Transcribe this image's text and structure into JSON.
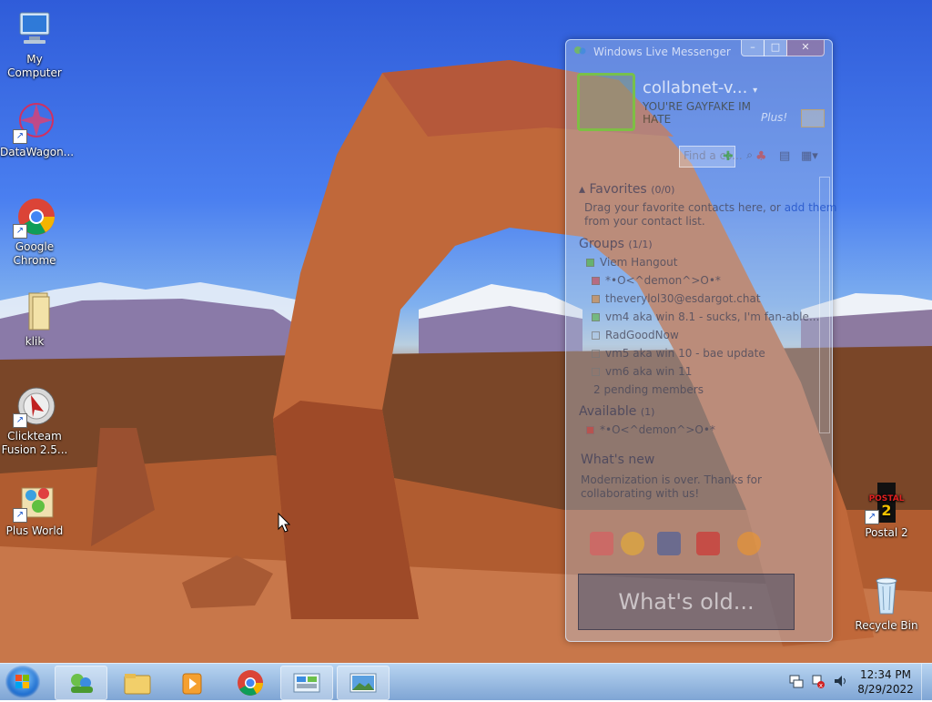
{
  "desktop": {
    "icons": [
      {
        "label": "My Computer",
        "icon": "computer-icon"
      },
      {
        "label": "DataWagon...",
        "icon": "datawagon-icon"
      },
      {
        "label": "Google Chrome",
        "icon": "chrome-icon"
      },
      {
        "label": "klik",
        "icon": "folder-icon"
      },
      {
        "label": "Clickteam Fusion 2.5...",
        "icon": "clickteam-icon"
      },
      {
        "label": "Plus World",
        "icon": "plus-world-icon"
      },
      {
        "label": "Postal 2",
        "icon": "postal2-icon"
      },
      {
        "label": "Recycle Bin",
        "icon": "recycle-bin-icon"
      }
    ]
  },
  "messenger": {
    "title": "Windows Live Messenger",
    "username": "collabnet-v...",
    "status_message": "YOU'RE GAYFAKE IM HATE",
    "search_placeholder": "Find a co...",
    "favorites_header": "Favorites",
    "favorites_count": "(0/0)",
    "favorites_hint_1": "Drag your favorite contacts here, or",
    "favorites_hint_link": "add them",
    "favorites_hint_2": "from your contact list.",
    "groups_header": "Groups",
    "groups_count": "(1/1)",
    "group_name": "Viem Hangout",
    "contacts": [
      {
        "name": "*•O<^demon^>O•*",
        "extra": ""
      },
      {
        "name": "theverylol30",
        "extra": "@esdargot.chat"
      },
      {
        "name": "vm4 aka win 8.1",
        "extra": " - sucks, I'm fan-able..."
      },
      {
        "name": "RadGoodNow",
        "extra": ""
      },
      {
        "name": "vm5 aka win 10",
        "extra": " - bae update"
      },
      {
        "name": "vm6 aka win 11",
        "extra": ""
      }
    ],
    "pending": "2 pending members",
    "available_header": "Available",
    "available_count": "(1)",
    "available_contact": "*•O<^demon^>O•*",
    "whats_new_header": "What's new",
    "whats_new_text": "Modernization is over. Thanks for collaborating with us!",
    "promo_text": "What's old...",
    "plus_label": "Plus!"
  },
  "taskbar": {
    "time": "12:34 PM",
    "date": "8/29/2022",
    "items": [
      "messenger-icon",
      "file-explorer-icon",
      "media-player-icon",
      "chrome-icon",
      "control-panel-icon",
      "photo-viewer-icon"
    ]
  }
}
